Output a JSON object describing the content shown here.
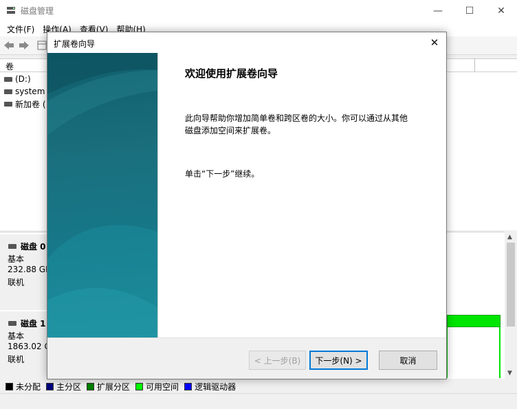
{
  "window": {
    "title": "磁盘管理",
    "minimize_glyph": "—",
    "maximize_glyph": "☐",
    "close_glyph": "✕"
  },
  "menu": [
    "文件(F)",
    "操作(A)",
    "查看(V)",
    "帮助(H)"
  ],
  "volume_list": {
    "column_header": "卷",
    "rows": [
      "(D:)",
      "system (",
      "新加卷 ("
    ]
  },
  "disks": [
    {
      "name": "磁盘 0",
      "type": "基本",
      "size": "232.88 GB",
      "status": "联机"
    },
    {
      "name": "磁盘 1",
      "type": "基本",
      "size": "1863.02 G",
      "status": "联机"
    }
  ],
  "legend": [
    {
      "label": "未分配",
      "color": "#000000"
    },
    {
      "label": "主分区",
      "color": "#00007f"
    },
    {
      "label": "扩展分区",
      "color": "#008000"
    },
    {
      "label": "可用空间",
      "color": "#00ff00"
    },
    {
      "label": "逻辑驱动器",
      "color": "#0000ff"
    }
  ],
  "dialog": {
    "title": "扩展卷向导",
    "close_glyph": "✕",
    "heading": "欢迎使用扩展卷向导",
    "description_line1": "此向导帮助你增加简单卷和跨区卷的大小。你可以通过从其他",
    "description_line2": "磁盘添加空间来扩展卷。",
    "continue_text": "单击“下一步”继续。",
    "back_button": "< 上一步(B)",
    "next_button": "下一步(N) >",
    "cancel_button": "取消"
  },
  "colors": {
    "accent": "#0078d7",
    "banner": "#16798a",
    "extended_partition": "#00e600"
  }
}
